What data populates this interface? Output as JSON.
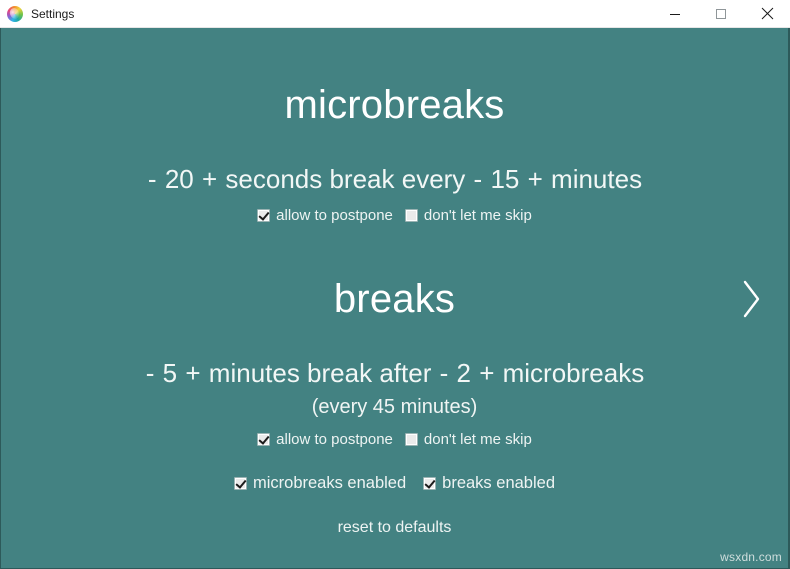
{
  "window": {
    "title": "Settings",
    "icon": "app-spiral-icon",
    "controls": {
      "minimize": "minimize-icon",
      "maximize": "maximize-icon",
      "close": "close-icon"
    }
  },
  "theme": {
    "background": "#438282",
    "text": "#ffffff",
    "titlebar_background": "#ffffff",
    "titlebar_text": "#1b1b1b"
  },
  "microbreaks": {
    "title": "microbreaks",
    "duration": {
      "minus": "-",
      "value": "20",
      "plus": "+",
      "unit": "seconds break every"
    },
    "interval": {
      "minus": "-",
      "value": "15",
      "plus": "+",
      "unit": "minutes"
    },
    "options": [
      {
        "label": "allow to postpone",
        "checked": true
      },
      {
        "label": "don't let me skip",
        "checked": false
      }
    ]
  },
  "breaks": {
    "title": "breaks",
    "duration": {
      "minus": "-",
      "value": "5",
      "plus": "+",
      "unit": "minutes break after"
    },
    "count": {
      "minus": "-",
      "value": "2",
      "plus": "+",
      "unit": "microbreaks"
    },
    "note": "(every 45 minutes)",
    "options": [
      {
        "label": "allow to postpone",
        "checked": true
      },
      {
        "label": "don't let me skip",
        "checked": false
      }
    ]
  },
  "enabled_row": [
    {
      "label": "microbreaks enabled",
      "checked": true
    },
    {
      "label": "breaks enabled",
      "checked": true
    }
  ],
  "reset": {
    "label": "reset to defaults"
  },
  "next_page": {
    "icon": "chevron-right-icon"
  },
  "watermark": {
    "text": "wsxdn.com"
  }
}
